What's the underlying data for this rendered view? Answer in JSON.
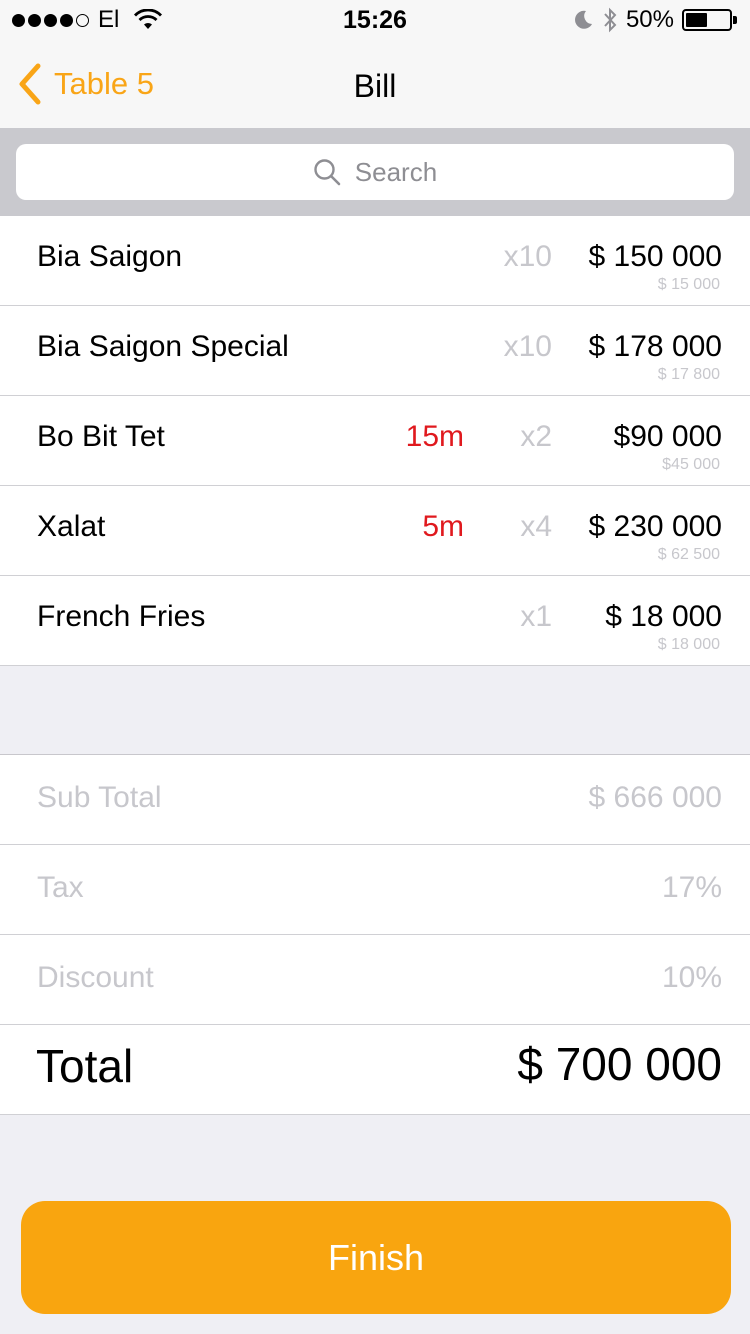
{
  "status_bar": {
    "carrier": "El",
    "time": "15:26",
    "battery_percent_label": "50%",
    "battery_level": 0.5
  },
  "nav": {
    "back_label": "Table 5",
    "title": "Bill"
  },
  "search": {
    "placeholder": "Search"
  },
  "items": [
    {
      "name": "Bia Saigon",
      "time": "",
      "qty": "x10",
      "price": "$ 150 000",
      "unit_price": "$ 15 000"
    },
    {
      "name": "Bia Saigon Special",
      "time": "",
      "qty": "x10",
      "price": "$ 178 000",
      "unit_price": "$ 17 800"
    },
    {
      "name": "Bo Bit Tet",
      "time": "15m",
      "qty": "x2",
      "price": "$90 000",
      "unit_price": "$45 000"
    },
    {
      "name": "Xalat",
      "time": "5m",
      "qty": "x4",
      "price": "$ 230 000",
      "unit_price": "$ 62 500"
    },
    {
      "name": "French Fries",
      "time": "",
      "qty": "x1",
      "price": "$ 18 000",
      "unit_price": "$ 18 000"
    }
  ],
  "summary": {
    "subtotal_label": "Sub Total",
    "subtotal_value": "$ 666 000",
    "tax_label": "Tax",
    "tax_value": "17%",
    "discount_label": "Discount",
    "discount_value": "10%",
    "total_label": "Total",
    "total_value": "$ 700 000"
  },
  "finish_label": "Finish",
  "colors": {
    "accent": "#f9a517",
    "time_red": "#e0191e",
    "muted": "#c7c7cc"
  }
}
